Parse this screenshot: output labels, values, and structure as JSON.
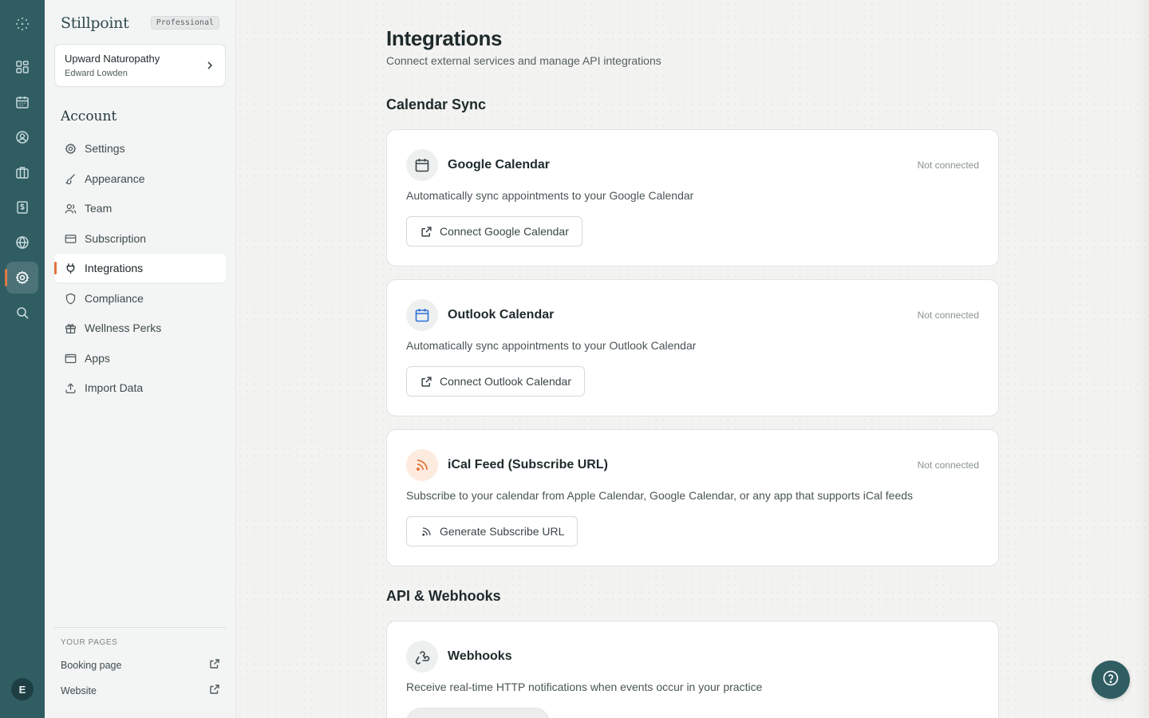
{
  "app": {
    "brand": "Stillpoint",
    "plan": "Professional",
    "accent": "#e0733a",
    "rail_color": "#2f5d62"
  },
  "rail": {
    "items": [
      {
        "name": "dashboard-icon",
        "active": false
      },
      {
        "name": "calendar-icon",
        "active": false
      },
      {
        "name": "clients-icon",
        "active": false
      },
      {
        "name": "services-icon",
        "active": false
      },
      {
        "name": "billing-icon",
        "active": false
      },
      {
        "name": "globe-icon",
        "active": false
      },
      {
        "name": "settings-icon",
        "active": true
      },
      {
        "name": "search-icon",
        "active": false
      }
    ],
    "avatar_initial": "E"
  },
  "sidebar": {
    "practice": {
      "name": "Upward Naturopathy",
      "user": "Edward Lowden"
    },
    "section_title": "Account",
    "items": [
      {
        "label": "Settings",
        "icon": "gear-icon",
        "active": false
      },
      {
        "label": "Appearance",
        "icon": "brush-icon",
        "active": false
      },
      {
        "label": "Team",
        "icon": "users-icon",
        "active": false
      },
      {
        "label": "Subscription",
        "icon": "card-icon",
        "active": false
      },
      {
        "label": "Integrations",
        "icon": "plug-icon",
        "active": true
      },
      {
        "label": "Compliance",
        "icon": "shield-icon",
        "active": false
      },
      {
        "label": "Wellness Perks",
        "icon": "gift-icon",
        "active": false
      },
      {
        "label": "Apps",
        "icon": "app-window-icon",
        "active": false
      },
      {
        "label": "Import Data",
        "icon": "upload-icon",
        "active": false
      }
    ],
    "pages_label": "YOUR PAGES",
    "pages": [
      {
        "label": "Booking page",
        "icon": "external-link-icon"
      },
      {
        "label": "Website",
        "icon": "external-link-icon"
      }
    ]
  },
  "main": {
    "title": "Integrations",
    "subtitle": "Connect external services and manage API integrations",
    "calendar_section": "Calendar Sync",
    "api_section": "API & Webhooks",
    "cards": [
      {
        "title": "Google Calendar",
        "status": "Not connected",
        "description": "Automatically sync appointments to your Google Calendar",
        "button": "Connect Google Calendar",
        "icon": "calendar-icon"
      },
      {
        "title": "Outlook Calendar",
        "status": "Not connected",
        "description": "Automatically sync appointments to your Outlook Calendar",
        "button": "Connect Outlook Calendar",
        "icon": "calendar-blue-icon"
      },
      {
        "title": "iCal Feed (Subscribe URL)",
        "status": "Not connected",
        "description": "Subscribe to your calendar from Apple Calendar, Google Calendar, or any app that supports iCal feeds",
        "button": "Generate Subscribe URL",
        "icon": "rss-icon"
      },
      {
        "title": "Webhooks",
        "description": "Receive real-time HTTP notifications when events occur in your practice",
        "icon": "webhook-icon"
      }
    ]
  }
}
